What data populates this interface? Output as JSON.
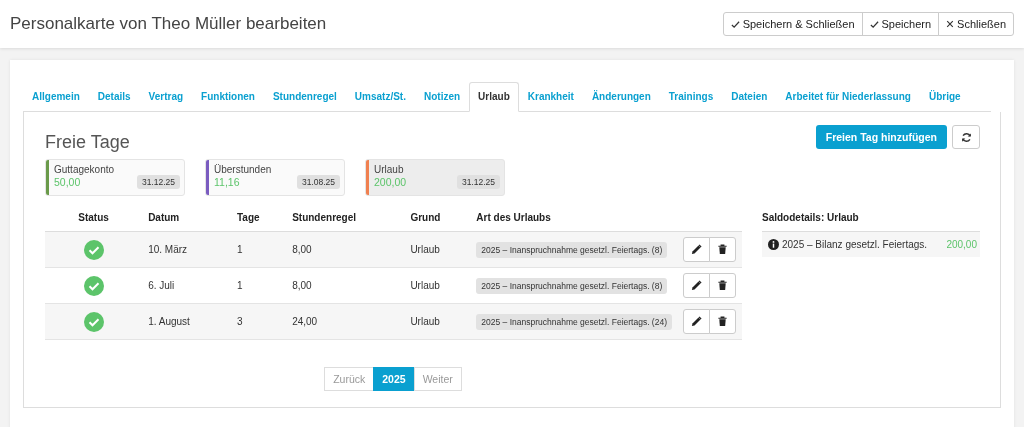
{
  "header": {
    "title": "Personalkarte von Theo Müller bearbeiten",
    "buttons": [
      {
        "label": "Speichern & Schließen",
        "kind": "confirm"
      },
      {
        "label": "Speichern",
        "kind": "confirm"
      },
      {
        "label": "Schließen",
        "kind": "cancel"
      }
    ]
  },
  "tabs": [
    {
      "label": "Allgemein",
      "selected": false
    },
    {
      "label": "Details",
      "selected": false
    },
    {
      "label": "Vertrag",
      "selected": false
    },
    {
      "label": "Funktionen",
      "selected": false
    },
    {
      "label": "Stundenregel",
      "selected": false
    },
    {
      "label": "Umsatz/St.",
      "selected": false
    },
    {
      "label": "Notizen",
      "selected": false
    },
    {
      "label": "Urlaub",
      "selected": true
    },
    {
      "label": "Krankheit",
      "selected": false
    },
    {
      "label": "Änderungen",
      "selected": false
    },
    {
      "label": "Trainings",
      "selected": false
    },
    {
      "label": "Dateien",
      "selected": false
    },
    {
      "label": "Arbeitet für Niederlassung",
      "selected": false
    },
    {
      "label": "Übrige",
      "selected": false
    }
  ],
  "section_title": "Freie Tage",
  "add_button": "Freien Tag hinzufügen",
  "balances": [
    {
      "name": "Guttagekonto",
      "value": "50,00",
      "date": "31.12.25",
      "color": "#6a9a4a",
      "selected": false
    },
    {
      "name": "Überstunden",
      "value": "11,16",
      "date": "31.08.25",
      "color": "#7a5cc0",
      "selected": false
    },
    {
      "name": "Urlaub",
      "value": "200,00",
      "date": "31.12.25",
      "color": "#f08050",
      "selected": true
    }
  ],
  "table": {
    "columns": [
      "Status",
      "Datum",
      "Tage",
      "Stundenregel",
      "Grund",
      "Art des Urlaubs"
    ],
    "rows": [
      {
        "approved": true,
        "date": "10. März",
        "days": "1",
        "hours": "8,00",
        "reason": "Urlaub",
        "type": "2025 – Inanspruchnahme gesetzl. Feiertags. (8)"
      },
      {
        "approved": true,
        "date": "6. Juli",
        "days": "1",
        "hours": "8,00",
        "reason": "Urlaub",
        "type": "2025 – Inanspruchnahme gesetzl. Feiertags. (8)"
      },
      {
        "approved": true,
        "date": "1. August",
        "days": "3",
        "hours": "24,00",
        "reason": "Urlaub",
        "type": "2025 – Inanspruchnahme gesetzl. Feiertags. (24)"
      }
    ]
  },
  "saldo": {
    "title": "Saldodetails: Urlaub",
    "rows": [
      {
        "label": "2025 – Bilanz gesetzl. Feiertags.",
        "value": "200,00"
      }
    ]
  },
  "pagination": [
    {
      "label": "Zurück",
      "selected": false
    },
    {
      "label": "2025",
      "selected": true
    },
    {
      "label": "Weiter",
      "selected": false
    }
  ]
}
